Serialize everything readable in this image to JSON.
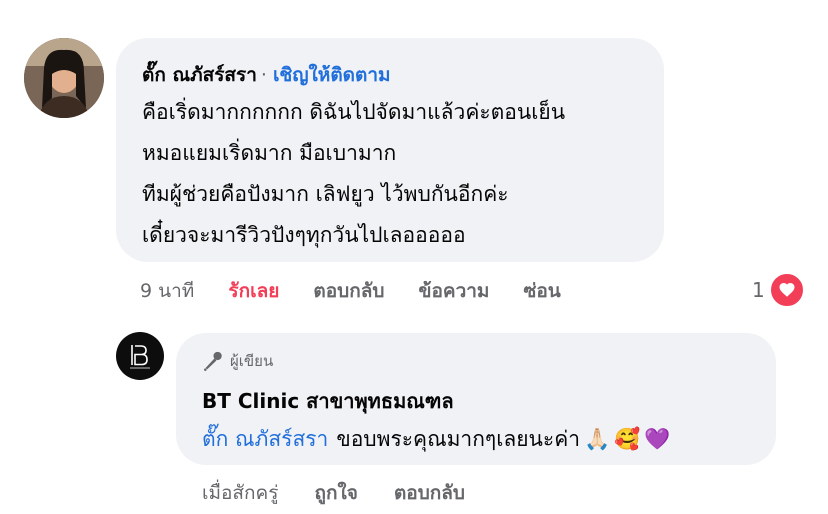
{
  "comment": {
    "author": "ตั๊ก ณภัสร์สรา",
    "separator": "·",
    "follow_label": "เชิญให้ติดตาม",
    "lines": [
      "คือเริ่ดมากกกกกก ดิฉันไปจัดมาแล้วค่ะตอนเย็น",
      "หมอแยมเริ่ดมาก มือเบามาก",
      "ทีมผู้ช่วยคือปังมาก เลิฟยูว ไว้พบกันอีกค่ะ",
      "เดี๋ยวจะมารีวิวปังๆทุกวันไปเลอออออ"
    ],
    "actions": {
      "time": "9 นาที",
      "like": "รักเลย",
      "reply": "ตอบกลับ",
      "message": "ข้อความ",
      "hide": "ซ่อน"
    },
    "reaction_count": "1",
    "reaction_color": "#f33e58"
  },
  "reply": {
    "badge": "ผู้เขียน",
    "author": "BT Clinic สาขาพุทธมณฑล",
    "mention": "ตั๊ก ณภัสร์สรา",
    "text": "ขอบพระคุณมากๆเลยนะค่า",
    "emojis": [
      "🙏🏻",
      "🥰",
      "💜"
    ],
    "actions": {
      "time": "เมื่อสักครู่",
      "like": "ถูกใจ",
      "reply": "ตอบกลับ"
    }
  },
  "colors": {
    "link": "#216fdb",
    "bubble": "#f0f2f5",
    "meta": "#65676b"
  }
}
